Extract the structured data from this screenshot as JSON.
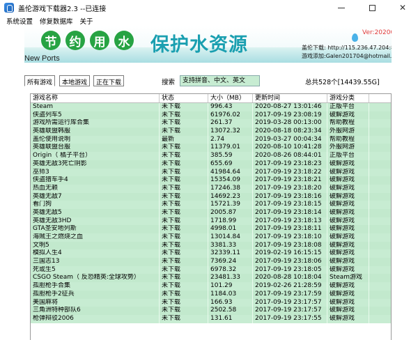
{
  "window": {
    "title": "盖伦游戏下载器2.3 --已连接"
  },
  "menu": [
    "系统设置",
    "修复数据库",
    "关于"
  ],
  "banner": {
    "slogan_chars": [
      "节",
      "约",
      "用",
      "水"
    ],
    "slogan_main": "保护水资源",
    "version": "Ver:20200820",
    "download_line": "盖伦下载: http://115.236.47.204:8000",
    "contact_line": "游戏添加:Galen201704@hotmail.com",
    "colors": {
      "leaf": "#27a343",
      "main_text": "#1a9fb0",
      "version": "#e03a3a"
    }
  },
  "new_ports": "New Ports",
  "tabs": [
    "所有游戏",
    "本地游戏",
    "正在下载"
  ],
  "search": {
    "label": "搜索",
    "placeholder": "支持拼音、中文、英文"
  },
  "total": "总共528个[14439.55G]",
  "table": {
    "columns": [
      "游戏名称",
      "状态",
      "大小（MB）",
      "更新时间",
      "游戏分类"
    ],
    "rows": [
      [
        "Steam",
        "未下载",
        "996.43",
        "2020-08-27 13:01:46",
        "正版平台"
      ],
      [
        "侠盗列车5",
        "未下载",
        "61976.02",
        "2017-09-19 23:08:19",
        "破解游戏"
      ],
      [
        "游戏所需运行库合集",
        "未下载",
        "261.37",
        "2019-03-28 00:13:00",
        "帮助教程"
      ],
      [
        "英雄联盟韩服",
        "未下载",
        "13072.32",
        "2020-08-18 08:23:34",
        "外服网游"
      ],
      [
        "盖伦使用说明",
        "最新",
        "2.74",
        "2019-03-27 00:04:34",
        "帮助教程"
      ],
      [
        "英雄联盟台服",
        "未下载",
        "11379.01",
        "2020-08-10 10:41:28",
        "外服网游"
      ],
      [
        "Origin（ 橘子平台）",
        "未下载",
        "385.59",
        "2020-08-26 08:44:01",
        "正版平台"
      ],
      [
        "英雄无敌3死亡阴影",
        "未下载",
        "655.69",
        "2017-09-19 23:18:23",
        "破解游戏"
      ],
      [
        "巫师3",
        "未下载",
        "41984.64",
        "2017-09-19 23:18:22",
        "破解游戏"
      ],
      [
        "侠盗猎车手4",
        "未下载",
        "15354.09",
        "2017-09-19 23:18:21",
        "破解游戏"
      ],
      [
        "热血无赖",
        "未下载",
        "17246.38",
        "2017-09-19 23:18:20",
        "破解游戏"
      ],
      [
        "英雄无敌7",
        "未下载",
        "14692.23",
        "2017-09-19 23:18:16",
        "破解游戏"
      ],
      [
        "看门狗",
        "未下载",
        "15721.39",
        "2017-09-19 23:18:15",
        "破解游戏"
      ],
      [
        "英雄无敌5",
        "未下载",
        "2005.87",
        "2017-09-19 23:18:14",
        "破解游戏"
      ],
      [
        "英雄无敌3HD",
        "未下载",
        "1718.99",
        "2017-09-19 23:18:13",
        "破解游戏"
      ],
      [
        "GTA圣安地列斯",
        "未下载",
        "4998.01",
        "2017-09-19 23:18:11",
        "破解游戏"
      ],
      [
        "海贼王之燃烧之血",
        "未下载",
        "13014.84",
        "2017-09-19 23:18:10",
        "破解游戏"
      ],
      [
        "文明5",
        "未下载",
        "3381.33",
        "2017-09-19 23:18:08",
        "破解游戏"
      ],
      [
        "模拟人生4",
        "未下载",
        "32339.11",
        "2019-02-19 16:15:15",
        "破解游戏"
      ],
      [
        "三国志13",
        "未下载",
        "7369.24",
        "2017-09-19 23:18:06",
        "破解游戏"
      ],
      [
        "死或生5",
        "未下载",
        "6978.32",
        "2017-09-19 23:18:05",
        "破解游戏"
      ],
      [
        "CSGO Steam（ 反恐精英:全球攻势）",
        "未下载",
        "23481.33",
        "2020-08-28 10:18:04",
        "Steam游戏"
      ],
      [
        "孤胆枪手合集",
        "未下载",
        "101.29",
        "2019-02-26 21:28:59",
        "破解游戏"
      ],
      [
        "孤胆枪手2征兵",
        "未下载",
        "1184.03",
        "2017-09-19 23:17:59",
        "破解游戏"
      ],
      [
        "美国麻将",
        "未下载",
        "166.93",
        "2017-09-19 23:17:57",
        "破解游戏"
      ],
      [
        "三角洲特种部队6",
        "未下载",
        "2502.58",
        "2017-09-19 23:17:57",
        "破解游戏"
      ],
      [
        "枪弹辩驳2006",
        "未下载",
        "131.61",
        "2017-09-19 23:17:55",
        "破解游戏"
      ]
    ]
  }
}
